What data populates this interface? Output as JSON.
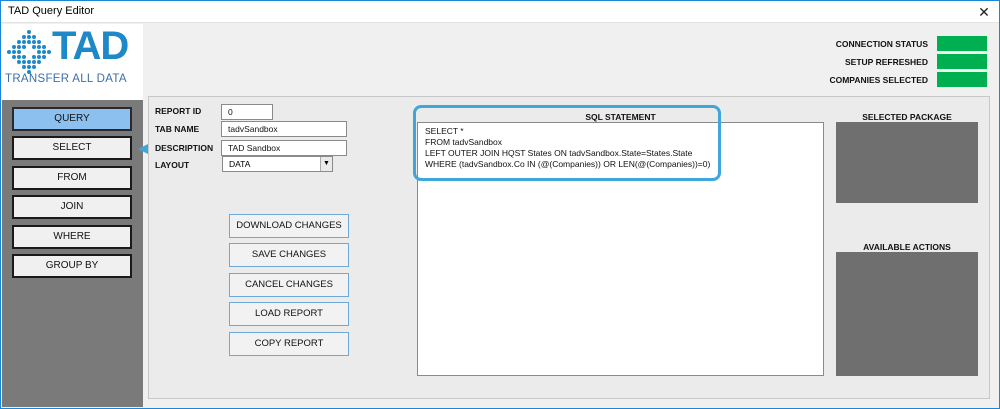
{
  "window": {
    "title": "TAD Query Editor",
    "close_glyph": "✕"
  },
  "logo": {
    "main": "TAD",
    "sub": "TRANSFER ALL DATA"
  },
  "nav": {
    "items": [
      {
        "label": "QUERY",
        "active": true
      },
      {
        "label": "SELECT"
      },
      {
        "label": "FROM"
      },
      {
        "label": "JOIN"
      },
      {
        "label": "WHERE"
      },
      {
        "label": "GROUP BY"
      }
    ]
  },
  "status": {
    "connection": "CONNECTION STATUS",
    "setup": "SETUP REFRESHED",
    "companies": "COMPANIES SELECTED",
    "color": "#00b050"
  },
  "form": {
    "report_id_label": "REPORT ID",
    "report_id_value": "0",
    "tab_name_label": "TAB NAME",
    "tab_name_value": "tadvSandbox",
    "description_label": "DESCRIPTION",
    "description_value": "TAD Sandbox",
    "layout_label": "LAYOUT",
    "layout_value": "DATA"
  },
  "actions": {
    "download": "DOWNLOAD CHANGES",
    "save": "SAVE CHANGES",
    "cancel": "CANCEL CHANGES",
    "load": "LOAD REPORT",
    "copy": "COPY REPORT"
  },
  "sql": {
    "title": "SQL STATEMENT",
    "lines": [
      "SELECT *",
      "FROM tadvSandbox",
      "LEFT OUTER JOIN HQST States ON tadvSandbox.State=States.State",
      "WHERE (tadvSandbox.Co IN (@(Companies)) OR LEN(@(Companies))=0)"
    ]
  },
  "panels": {
    "selected_package": "SELECTED PACKAGE",
    "available_actions": "AVAILABLE ACTIONS"
  },
  "colors": {
    "accent": "#3fa6da",
    "nav_active": "#8cc0ee",
    "left_panel": "#7a7a7a"
  }
}
